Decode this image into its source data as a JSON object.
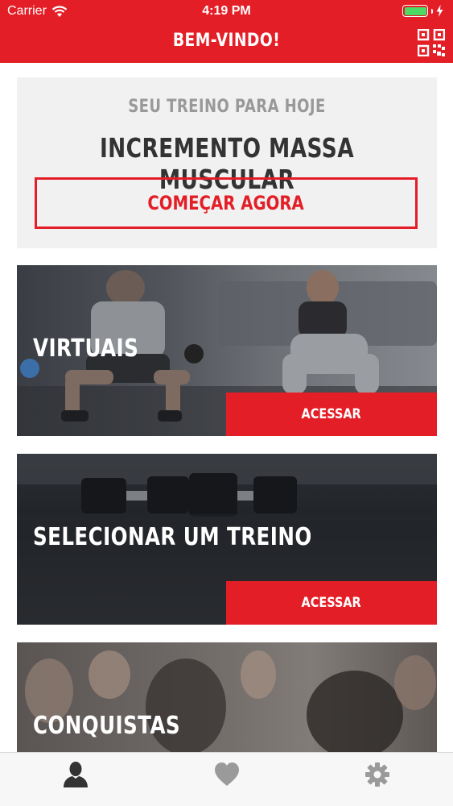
{
  "status_bar": {
    "carrier": "Carrier",
    "time": "4:19 PM"
  },
  "header": {
    "title": "BEM-VINDO!",
    "qr_icon": "qr-code-icon"
  },
  "today": {
    "label": "SEU TREINO PARA HOJE",
    "workout_name": "INCREMENTO MASSA MUSCULAR",
    "start_label": "COMEÇAR AGORA"
  },
  "cards": [
    {
      "title": "VIRTUAIS",
      "button_label": "ACESSAR"
    },
    {
      "title": "SELECIONAR UM TREINO",
      "button_label": "ACESSAR"
    },
    {
      "title": "CONQUISTAS"
    }
  ],
  "tab_bar": {
    "tabs": [
      {
        "icon": "profile-icon",
        "active": true
      },
      {
        "icon": "heart-icon",
        "active": false
      },
      {
        "icon": "gear-icon",
        "active": false
      }
    ]
  },
  "colors": {
    "brand_red": "#e41e26",
    "battery_green": "#4cd964",
    "tab_active": "#333333",
    "tab_inactive": "#9a9a9a"
  }
}
